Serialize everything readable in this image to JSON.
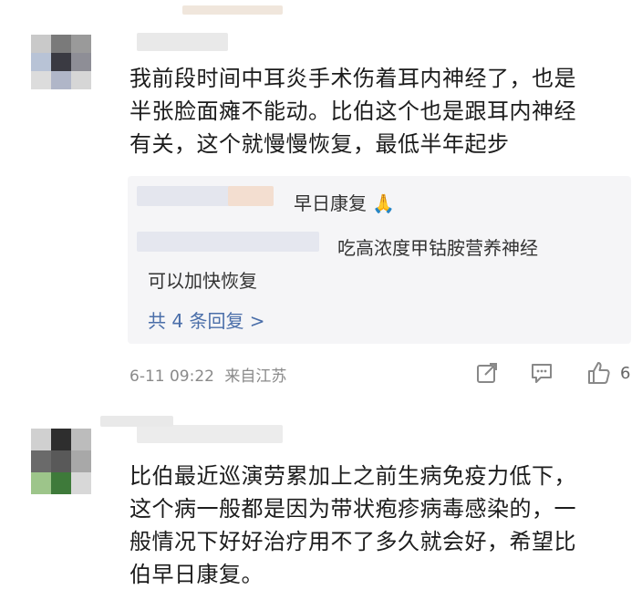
{
  "comments": [
    {
      "text": "我前段时间中耳炎手术伤着耳内神经了，也是半张脸面瘫不能动。比伯这个也是跟耳内神经有关，这个就慢慢恢复，最低半年起步",
      "lines": [
        "我前段时间中耳炎手术伤着耳内神经了，也是",
        "半张脸面瘫不能动。比伯这个也是跟耳内神经",
        "有关，这个就慢慢恢复，最低半年起步"
      ],
      "replies": [
        {
          "text": "早日康复",
          "emoji": "🙏"
        },
        {
          "text": "吃高浓度甲钴胺营养神经",
          "continuation": "可以加快恢复"
        }
      ],
      "more_replies_label": "共 4 条回复 >",
      "timestamp": "6-11 09:22",
      "location": "来自江苏",
      "like_count": "6"
    },
    {
      "lines": [
        "比伯最近巡演劳累加上之前生病免疫力低下，",
        "这个病一般都是因为带状疱疹病毒感染的，一",
        "般情况下好好治疗用不了多久就会好，希望比",
        "伯早日康复。"
      ]
    }
  ],
  "icons": {
    "share": "share-icon",
    "reply": "comment-icon",
    "like": "thumbs-up-icon"
  },
  "colors": {
    "link": "#4a6ea9",
    "meta": "#8a8a8a",
    "reply_bg": "#f5f5f7"
  }
}
